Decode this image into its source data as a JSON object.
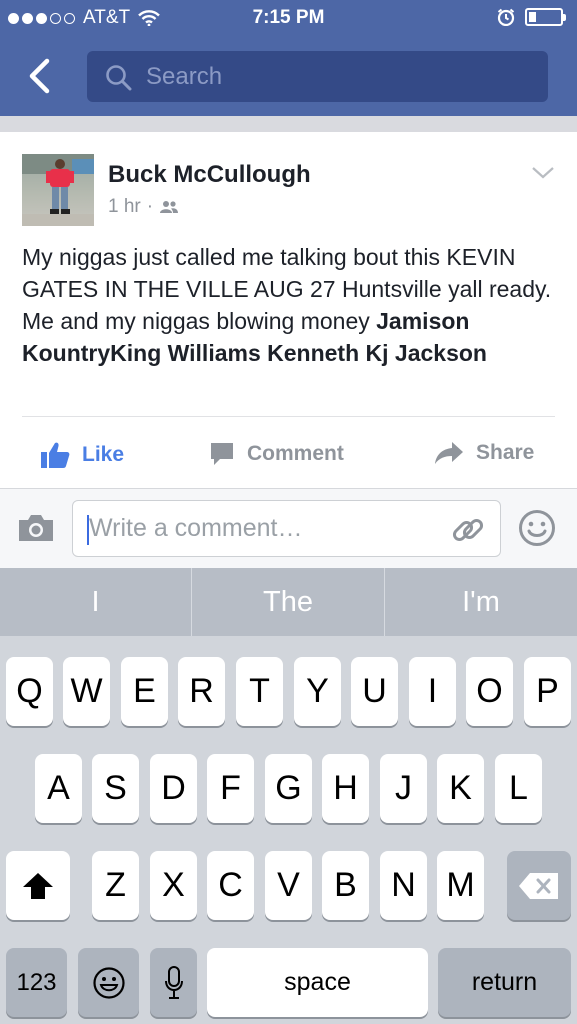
{
  "status_bar": {
    "carrier": "AT&T",
    "time": "7:15 PM",
    "signal_icon": "signal-dots-icon",
    "wifi_icon": "wifi-icon",
    "alarm_icon": "alarm-clock-icon",
    "battery_icon": "battery-icon",
    "battery_level": 0.2
  },
  "nav": {
    "back_icon": "chevron-left-icon",
    "search_placeholder": "Search"
  },
  "post": {
    "author": "Buck McCullough",
    "time_ago": "1 hr",
    "separator": "·",
    "audience_icon": "friends-icon",
    "text": "My niggas just called me talking bout this KEVIN GATES IN THE VILLE AUG 27 Huntsville yall ready. Me and my niggas blowing money ",
    "tagged": "Jamison KountryKing Williams Kenneth Kj Jackson",
    "actions": {
      "like": "Like",
      "comment": "Comment",
      "share": "Share"
    }
  },
  "comment_bar": {
    "placeholder": "Write a comment…"
  },
  "keyboard": {
    "suggestions": [
      "I",
      "The",
      "I'm"
    ],
    "row1": [
      "Q",
      "W",
      "E",
      "R",
      "T",
      "Y",
      "U",
      "I",
      "O",
      "P"
    ],
    "row2": [
      "A",
      "S",
      "D",
      "F",
      "G",
      "H",
      "J",
      "K",
      "L"
    ],
    "row3": [
      "Z",
      "X",
      "C",
      "V",
      "B",
      "N",
      "M"
    ],
    "numbers_label": "123",
    "space_label": "space",
    "return_label": "return"
  },
  "colors": {
    "header": "#4d67a6",
    "search_field": "#344a87",
    "like_blue": "#4a7ee4"
  }
}
